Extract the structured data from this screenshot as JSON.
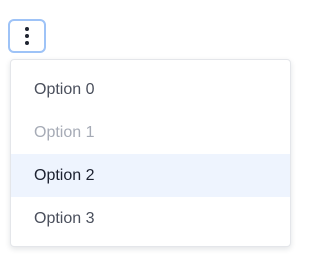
{
  "trigger": {
    "icon": "kebab-vertical-icon"
  },
  "menu": {
    "items": [
      {
        "label": "Option 0",
        "state": "normal"
      },
      {
        "label": "Option 1",
        "state": "disabled"
      },
      {
        "label": "Option 2",
        "state": "highlighted"
      },
      {
        "label": "Option 3",
        "state": "normal"
      }
    ]
  },
  "colors": {
    "focus_ring": "#9ec3f7",
    "highlight_bg": "#eef4fe",
    "text": "#4a4f5c",
    "disabled_text": "#a6abb6"
  }
}
